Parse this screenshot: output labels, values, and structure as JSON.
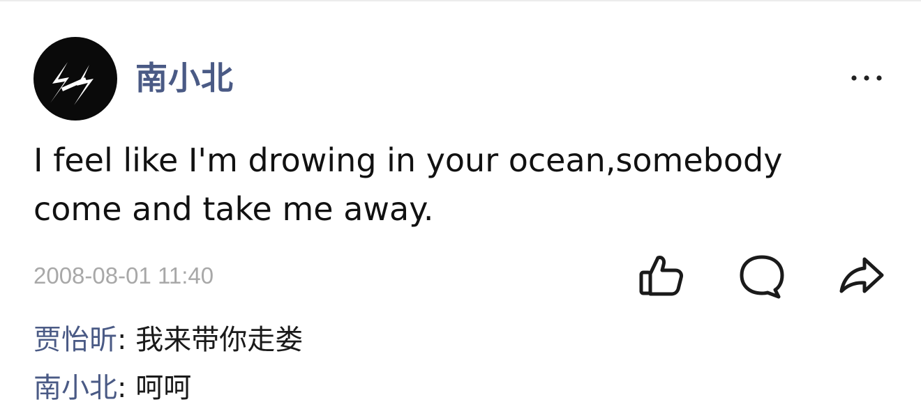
{
  "post": {
    "author": "南小北",
    "avatar_icon": "lightning-bolt-icon",
    "text": "I feel like I'm drowing in your ocean,somebody come and take me away.",
    "timestamp": "2008-08-01 11:40"
  },
  "actions": {
    "more_icon": "ellipsis-icon",
    "like_icon": "thumbs-up-icon",
    "comment_icon": "speech-bubble-icon",
    "share_icon": "share-arrow-icon"
  },
  "comments": [
    {
      "author": "贾怡昕",
      "separator": ": ",
      "text": "我来带你走娄"
    },
    {
      "author": "南小北",
      "separator": ": ",
      "text": "呵呵"
    }
  ],
  "colors": {
    "name_accent": "#4a5a85",
    "text": "#111111",
    "timestamp": "#a8a8a8",
    "avatar_bg": "#0a0a0a"
  }
}
